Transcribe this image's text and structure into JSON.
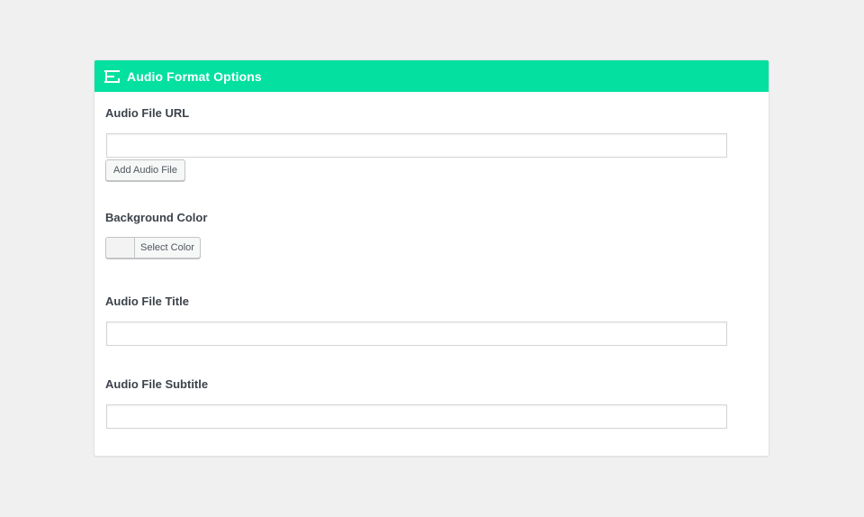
{
  "panel": {
    "title": "Audio Format Options",
    "icon": "format-icon",
    "header_color": "#03e0a0"
  },
  "fields": {
    "audio_url": {
      "label": "Audio File URL",
      "value": "",
      "button_label": "Add Audio File"
    },
    "background_color": {
      "label": "Background Color",
      "button_label": "Select Color"
    },
    "audio_title": {
      "label": "Audio File Title",
      "value": ""
    },
    "audio_subtitle": {
      "label": "Audio File Subtitle",
      "value": ""
    }
  }
}
